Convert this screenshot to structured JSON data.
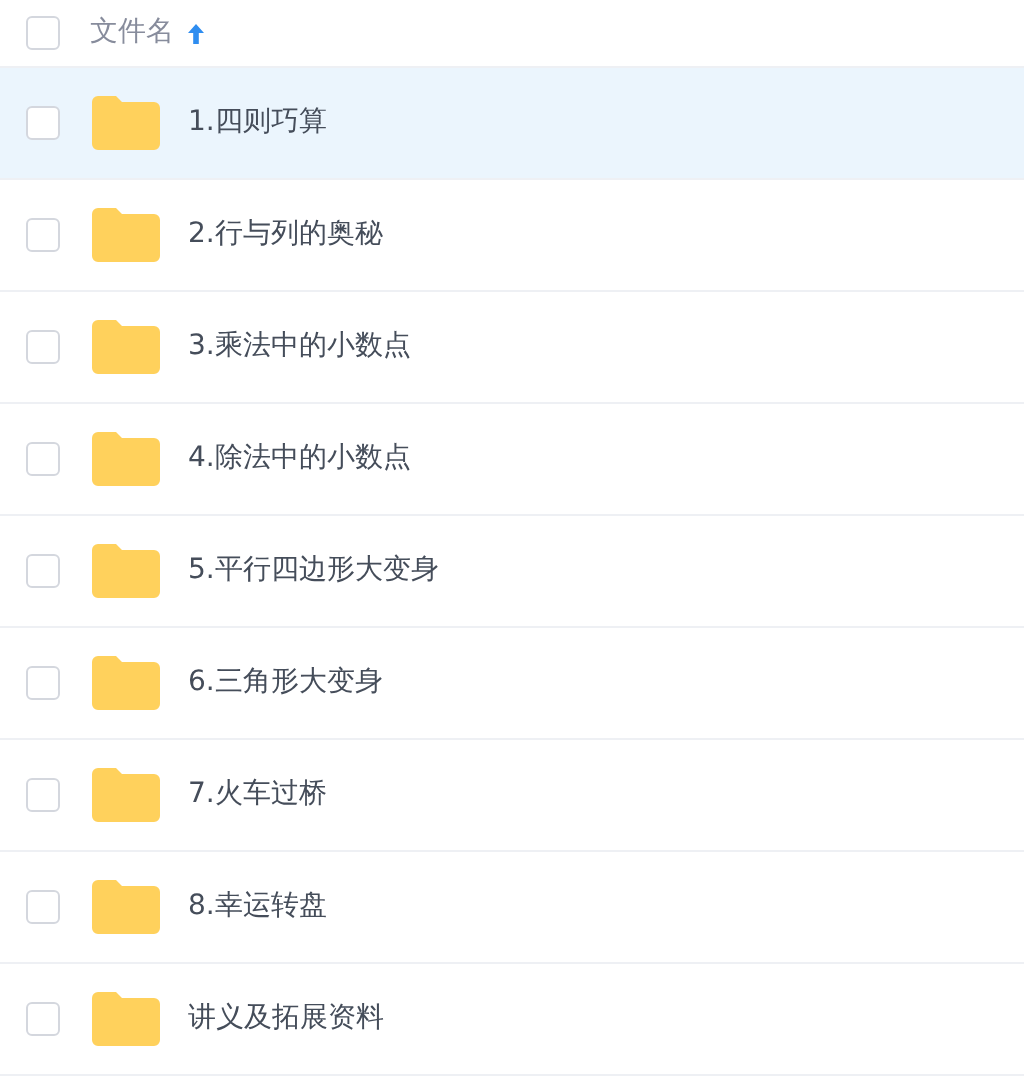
{
  "header": {
    "checked": false,
    "column": "文件名",
    "sort_ascending": true
  },
  "rows": [
    {
      "name": "1.四则巧算",
      "selected": true,
      "checked": false
    },
    {
      "name": "2.行与列的奥秘",
      "selected": false,
      "checked": false
    },
    {
      "name": "3.乘法中的小数点",
      "selected": false,
      "checked": false
    },
    {
      "name": "4.除法中的小数点",
      "selected": false,
      "checked": false
    },
    {
      "name": "5.平行四边形大变身",
      "selected": false,
      "checked": false
    },
    {
      "name": "6.三角形大变身",
      "selected": false,
      "checked": false
    },
    {
      "name": "7.火车过桥",
      "selected": false,
      "checked": false
    },
    {
      "name": "8.幸运转盘",
      "selected": false,
      "checked": false
    },
    {
      "name": "讲义及拓展资料",
      "selected": false,
      "checked": false
    }
  ]
}
